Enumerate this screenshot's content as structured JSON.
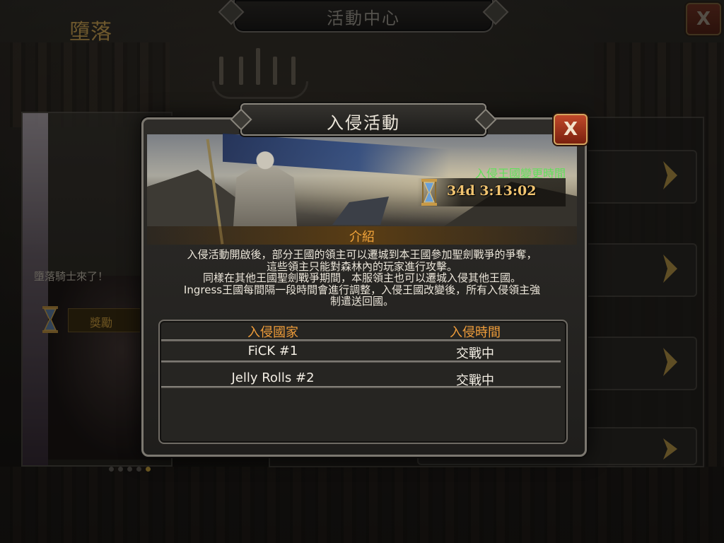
{
  "header": {
    "title": "活動中心"
  },
  "left_card": {
    "title": "墮落",
    "description": "墮落騎士來了！",
    "reward_label": "獎勵",
    "page_dots": 5,
    "active_dot": 4
  },
  "dialog": {
    "title": "入侵活動",
    "close_label": "X",
    "timer": {
      "label": "入侵王國變更時間",
      "value": "34d 3:13:02"
    },
    "intro_label": "介紹",
    "description_lines": [
      "入侵活動開啟後，部分王國的領主可以遷城到本王國參加聖劍戰爭的爭奪，",
      "這些領主只能對森林內的玩家進行攻擊。",
      "同樣在其他王國聖劍戰爭期間，本服領主也可以遷城入侵其他王國。",
      "Ingress王國每間隔一段時間會進行調整，入侵王國改變後，所有入侵領主強",
      "制遣送回國。"
    ],
    "table": {
      "headers": [
        "入侵國家",
        "入侵時間"
      ],
      "rows": [
        {
          "kingdom": "FiCK #1",
          "status": "交戰中"
        },
        {
          "kingdom": "Jelly Rolls #2",
          "status": "交戰中"
        }
      ]
    }
  },
  "top_close_label": "X",
  "colors": {
    "accent_gold": "#f09d3a",
    "timer_green": "#5fe05a",
    "timer_gold": "#f1c470",
    "close_red": "#b8401f"
  }
}
